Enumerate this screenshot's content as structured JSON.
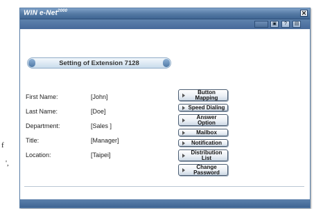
{
  "side_fragment": {
    "line1": "f",
    "line2": "',"
  },
  "window": {
    "title": "WIN e-Net",
    "title_suffix": "2000",
    "close_glyph": "✕"
  },
  "toolbar": {
    "buttons": [
      {
        "icon": "monitor-icon",
        "glyph": "▣"
      },
      {
        "icon": "help-icon",
        "glyph": "?"
      },
      {
        "icon": "print-icon",
        "glyph": "▤"
      }
    ]
  },
  "header": {
    "title": "Setting of Extension 7128"
  },
  "fields": [
    {
      "label": "First Name:",
      "value": "[John]"
    },
    {
      "label": "Last Name:",
      "value": "[Doe]"
    },
    {
      "label": "Department:",
      "value": "[Sales ]"
    },
    {
      "label": "Title:",
      "value": "[Manager]"
    },
    {
      "label": "Location:",
      "value": "[Taipei]"
    }
  ],
  "actions": [
    {
      "label": "Button Mapping"
    },
    {
      "label": "Speed Dialing"
    },
    {
      "label": "Answer Option"
    },
    {
      "label": "Mailbox"
    },
    {
      "label": "Notification"
    },
    {
      "label": "Distribution List"
    },
    {
      "label": "Change Password"
    }
  ]
}
